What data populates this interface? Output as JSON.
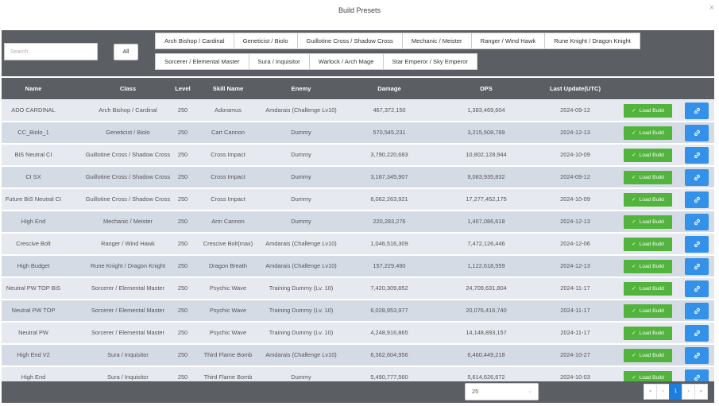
{
  "dialog": {
    "title": "Build Presets",
    "close_icon": "×"
  },
  "search": {
    "placeholder": "Search",
    "value": ""
  },
  "filters": {
    "all_label": "All",
    "row1": [
      "Arch Bishop / Cardinal",
      "Geneticist / Biolo",
      "Guillotine Cross / Shadow Cross",
      "Mechanic / Meister",
      "Ranger / Wind Hawk",
      "Rune Knight / Dragon Knight"
    ],
    "row2": [
      "Sorcerer / Elemental Master",
      "Sura / Inquisitor",
      "Warlock / Arch Mage",
      "Star Emperor / Sky Emperor"
    ]
  },
  "table": {
    "headers": {
      "name": "Name",
      "class": "Class",
      "level": "Level",
      "skill": "Skill Name",
      "enemy": "Enemy",
      "damage": "Damage",
      "dps": "DPS",
      "last_update": "Last Update(UTC)"
    },
    "load_button_label": "Load Build",
    "rows": [
      {
        "name": "ADO CARDINAL",
        "class": "Arch Bishop / Cardinal",
        "level": "250",
        "skill": "Adoramus",
        "enemy": "Amdarais (Challenge Lv10)",
        "damage": "467,372,150",
        "dps": "1,383,469,604",
        "date": "2024-09-12"
      },
      {
        "name": "CC_Biolo_1",
        "class": "Geneticist / Biolo",
        "level": "250",
        "skill": "Cart Cannon",
        "enemy": "Dummy",
        "damage": "570,545,231",
        "dps": "3,215,508,789",
        "date": "2024-12-13"
      },
      {
        "name": "BiS Neutral CI",
        "class": "Guillotine Cross / Shadow Cross",
        "level": "250",
        "skill": "Cross Impact",
        "enemy": "Dummy",
        "damage": "3,790,220,683",
        "dps": "10,802,128,944",
        "date": "2024-10-09"
      },
      {
        "name": "CI SX",
        "class": "Guillotine Cross / Shadow Cross",
        "level": "250",
        "skill": "Cross Impact",
        "enemy": "Dummy",
        "damage": "3,187,345,907",
        "dps": "9,083,935,832",
        "date": "2024-09-12"
      },
      {
        "name": "Future BiS Neutral CI",
        "class": "Guillotine Cross / Shadow Cross",
        "level": "250",
        "skill": "Cross Impact",
        "enemy": "Dummy",
        "damage": "6,062,263,921",
        "dps": "17,277,452,175",
        "date": "2024-10-09"
      },
      {
        "name": "High End",
        "class": "Mechanic / Meister",
        "level": "250",
        "skill": "Arm Cannon",
        "enemy": "Dummy",
        "damage": "220,283,276",
        "dps": "1,467,086,618",
        "date": "2024-12-13"
      },
      {
        "name": "Crescive Bolt",
        "class": "Ranger / Wind Hawk",
        "level": "250",
        "skill": "Crescive Bolt(max)",
        "enemy": "Amdarais (Challenge Lv10)",
        "damage": "1,046,516,309",
        "dps": "7,472,126,446",
        "date": "2024-12-06"
      },
      {
        "name": "High Budget",
        "class": "Rune Knight / Dragon Knight",
        "level": "250",
        "skill": "Dragon Breath",
        "enemy": "Amdarais (Challenge Lv10)",
        "damage": "157,229,490",
        "dps": "1,122,618,559",
        "date": "2024-12-13"
      },
      {
        "name": "Neutral PW TOP BiS",
        "class": "Sorcerer / Elemental Master",
        "level": "250",
        "skill": "Psychic Wave",
        "enemy": "Training Dummy (Lv. 10)",
        "damage": "7,420,309,852",
        "dps": "24,709,631,804",
        "date": "2024-11-17"
      },
      {
        "name": "Neutral PW TOP",
        "class": "Sorcerer / Elemental Master",
        "level": "250",
        "skill": "Psychic Wave",
        "enemy": "Training Dummy (Lv. 10)",
        "damage": "6,028,953,977",
        "dps": "20,076,416,740",
        "date": "2024-11-17"
      },
      {
        "name": "Neutral PW",
        "class": "Sorcerer / Elemental Master",
        "level": "250",
        "skill": "Psychic Wave",
        "enemy": "Training Dummy (Lv. 10)",
        "damage": "4,248,916,865",
        "dps": "14,148,893,157",
        "date": "2024-11-17"
      },
      {
        "name": "High End V2",
        "class": "Sura / Inquisitor",
        "level": "250",
        "skill": "Third Flame Bomb",
        "enemy": "Amdarais (Challenge Lv10)",
        "damage": "6,362,604,956",
        "dps": "6,460,449,218",
        "date": "2024-10-27"
      },
      {
        "name": "High End",
        "class": "Sura / Inquisitor",
        "level": "250",
        "skill": "Third Flame Bomb",
        "enemy": "Dummy",
        "damage": "5,490,777,560",
        "dps": "5,614,626,672",
        "date": "2024-10-03"
      }
    ]
  },
  "footer": {
    "page_size": "25",
    "pager": {
      "first": "«",
      "prev": "‹",
      "current": "1",
      "next": "›",
      "last": "»"
    }
  },
  "colors": {
    "header_bg": "#5b5e63",
    "row_light": "#e6e9ef",
    "row_dark": "#d5dbe5",
    "load_green": "#52b33d",
    "link_blue": "#3391ea",
    "page_active": "#1e7ee0"
  },
  "icons": {
    "load": "check-icon",
    "link": "link-icon",
    "dropdown": "chevron-down-icon"
  }
}
